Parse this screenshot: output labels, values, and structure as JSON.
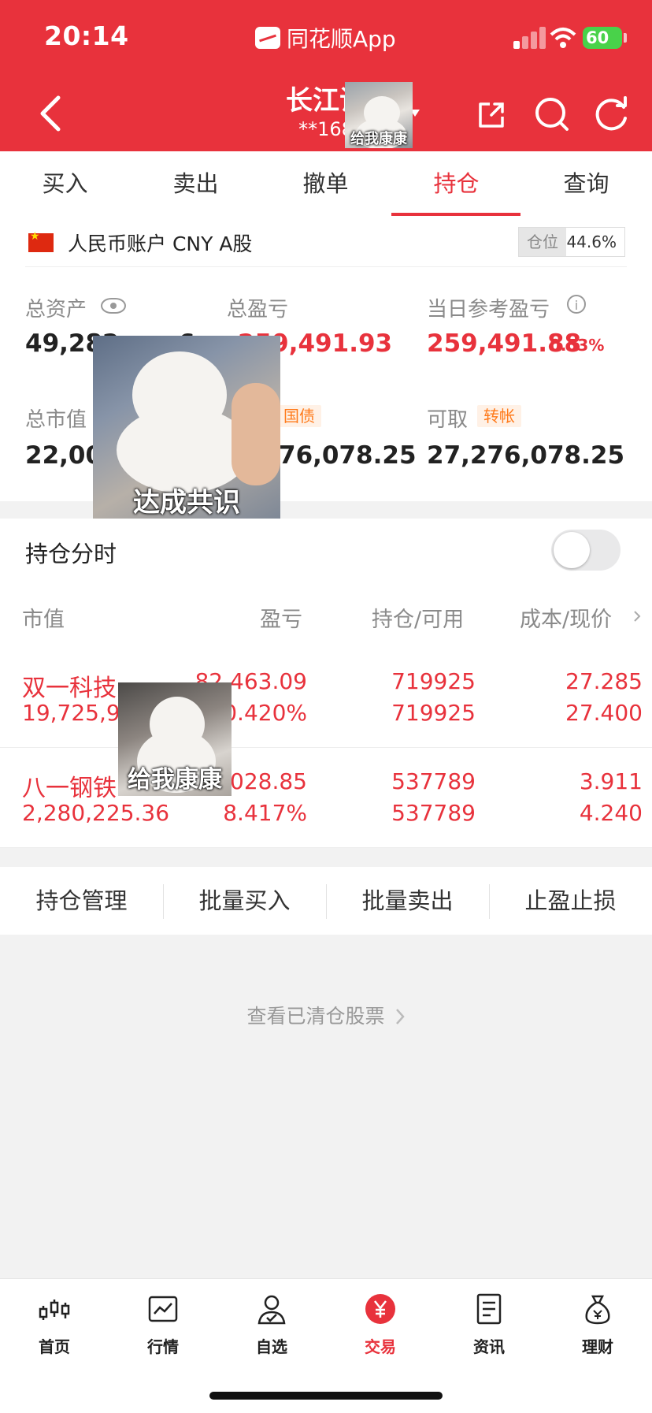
{
  "status_bar": {
    "time": "20:14",
    "app_name": "同花顺App",
    "battery": "60"
  },
  "nav": {
    "title": "长江证",
    "account_masked": "**168"
  },
  "tabs": [
    {
      "label": "买入"
    },
    {
      "label": "卖出"
    },
    {
      "label": "撤单"
    },
    {
      "label": "持仓",
      "active": true
    },
    {
      "label": "查询"
    }
  ],
  "account": {
    "label": "人民币账户 CNY A股",
    "position_label": "仓位",
    "position_ratio": "44.6%",
    "position_fraction": 0.446
  },
  "metrics": {
    "total_assets_label": "总资产",
    "total_assets_value": "49,282,",
    "total_assets_tail": "6",
    "total_pnl_label": "总盈亏",
    "total_pnl_value": "259,491.93",
    "daily_pnl_label": "当日参考盈亏",
    "daily_pnl_value": "259,491.88",
    "daily_pnl_pct": "0.53%",
    "market_value_label": "总市值",
    "market_value_value": "22,006",
    "bond_tag": "国债",
    "available_value": "76,078.25",
    "withdrawable_label": "可取",
    "transfer_tag": "转帐",
    "withdrawable_value": "27,276,078.25"
  },
  "stickers": {
    "top_caption": "给我康康",
    "middle_caption": "达成共识",
    "row_caption": "给我康康"
  },
  "holdings_intraday": {
    "label": "持仓分时",
    "enabled": false
  },
  "table": {
    "headers": {
      "market_value": "市值",
      "pnl": "盈亏",
      "position": "持仓/可用",
      "cost_price": "成本/现价"
    },
    "rows": [
      {
        "name": "双一科技",
        "market_value": "19,725,94",
        "pnl": "82,463.09",
        "pnl_pct": "0.420%",
        "position": "719925",
        "available": "719925",
        "cost": "27.285",
        "price": "27.400"
      },
      {
        "name": "八一钢铁",
        "market_value": "2,280,225.36",
        "pnl": "028.85",
        "pnl_pct": "8.417%",
        "position": "537789",
        "available": "537789",
        "cost": "3.911",
        "price": "4.240"
      }
    ]
  },
  "actions": [
    {
      "label": "持仓管理"
    },
    {
      "label": "批量买入"
    },
    {
      "label": "批量卖出"
    },
    {
      "label": "止盈止损"
    }
  ],
  "cleared_link": "查看已清仓股票",
  "bottom_nav": [
    {
      "label": "首页",
      "icon": "candlestick-icon"
    },
    {
      "label": "行情",
      "icon": "chart-icon"
    },
    {
      "label": "自选",
      "icon": "user-check-icon"
    },
    {
      "label": "交易",
      "icon": "yen-icon",
      "active": true
    },
    {
      "label": "资讯",
      "icon": "news-icon"
    },
    {
      "label": "理财",
      "icon": "money-bag-icon"
    }
  ],
  "colors": {
    "brand_red": "#e8323c",
    "orange_tag": "#ff7a1a"
  }
}
